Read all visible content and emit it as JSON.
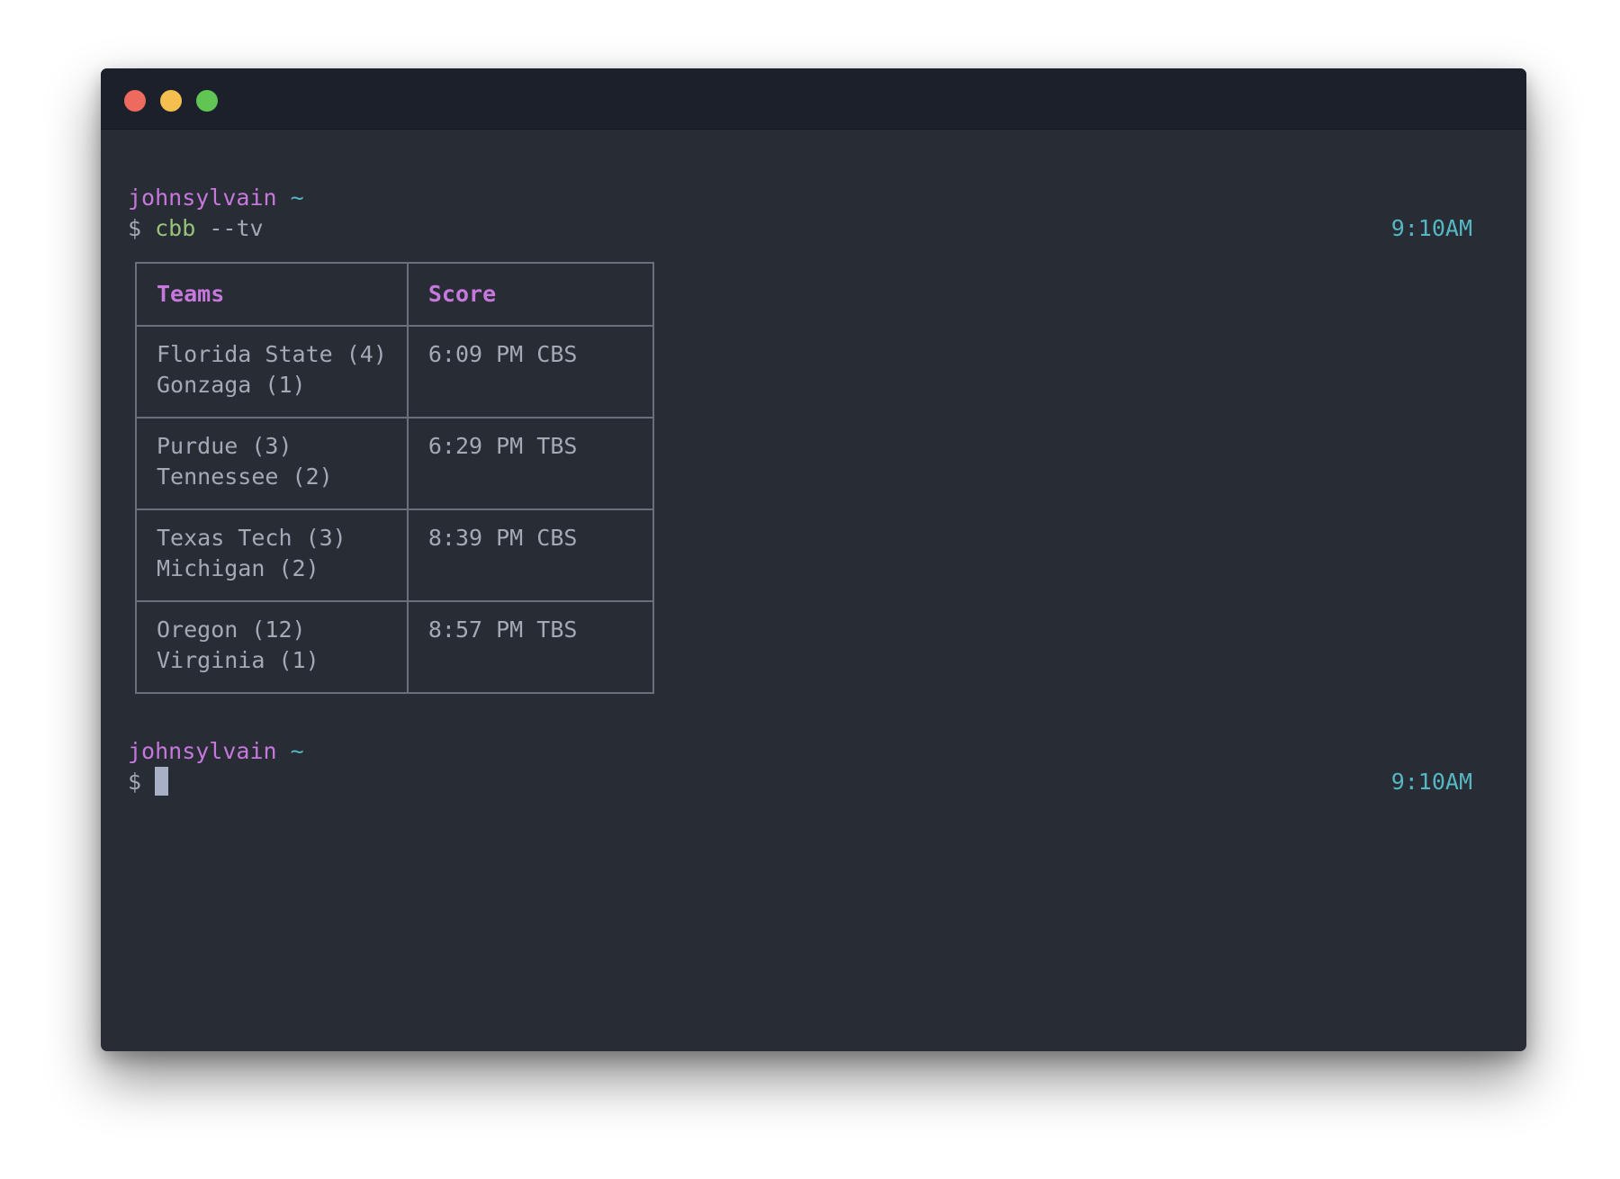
{
  "window": {
    "controls": [
      "close",
      "minimize",
      "zoom"
    ]
  },
  "session1": {
    "user": "johnsylvain",
    "dir": "~",
    "prompt_symbol": "$",
    "command": "cbb",
    "args": "--tv",
    "time": "9:10AM"
  },
  "table": {
    "headers": [
      "Teams",
      "Score"
    ],
    "rows": [
      {
        "team1": "Florida State (4)",
        "team2": "Gonzaga (1)",
        "score": "6:09 PM CBS"
      },
      {
        "team1": "Purdue (3)",
        "team2": "Tennessee (2)",
        "score": "6:29 PM TBS"
      },
      {
        "team1": "Texas Tech (3)",
        "team2": "Michigan (2)",
        "score": "8:39 PM CBS"
      },
      {
        "team1": "Oregon (12)",
        "team2": "Virginia (1)",
        "score": "8:57 PM TBS"
      }
    ]
  },
  "session2": {
    "user": "johnsylvain",
    "dir": "~",
    "prompt_symbol": "$",
    "time": "9:10AM"
  },
  "colors": {
    "background": "#282c35",
    "titlebar": "#1c202b",
    "user": "#c678dd",
    "time": "#56b6c2",
    "command": "#98c379",
    "text": "#a3a9b5"
  }
}
